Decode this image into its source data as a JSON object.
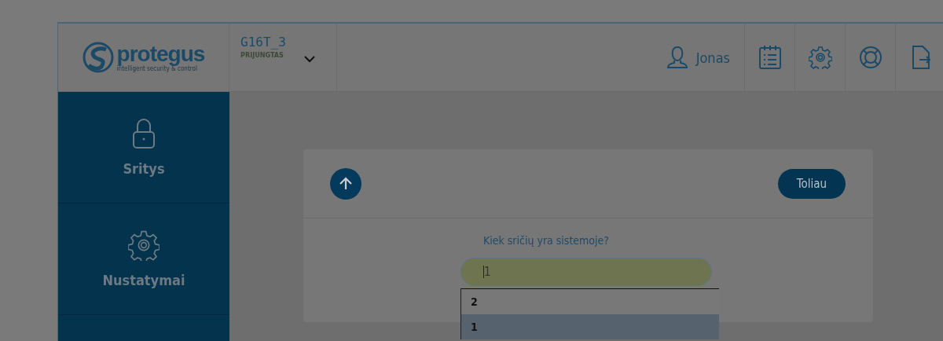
{
  "logo": {
    "name": "protegus",
    "tagline": "intelligent security & control"
  },
  "device": {
    "name": "G16T_3",
    "status": "PRIJUNGTAS"
  },
  "user": {
    "name": "Jonas"
  },
  "sidebar": {
    "items": [
      {
        "label": "Sritys",
        "kind": "lock"
      },
      {
        "label": "Nustatymai",
        "kind": "gear"
      }
    ]
  },
  "card": {
    "next_button": "Toliau",
    "question": "Kiek sričių yra sistemoje?",
    "field": {
      "value": "1"
    },
    "options": [
      {
        "label": "2",
        "selected": false
      },
      {
        "label": "1",
        "selected": true
      }
    ]
  }
}
